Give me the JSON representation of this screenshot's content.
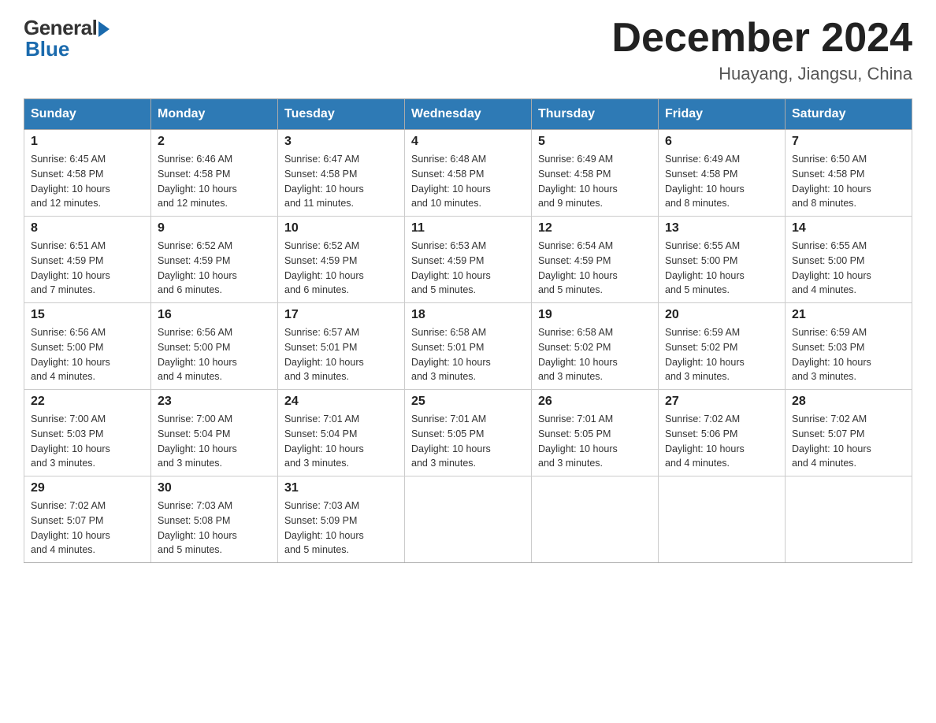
{
  "header": {
    "logo_general": "General",
    "logo_blue": "Blue",
    "month_title": "December 2024",
    "subtitle": "Huayang, Jiangsu, China"
  },
  "days_of_week": [
    "Sunday",
    "Monday",
    "Tuesday",
    "Wednesday",
    "Thursday",
    "Friday",
    "Saturday"
  ],
  "weeks": [
    [
      {
        "day": "1",
        "sunrise": "6:45 AM",
        "sunset": "4:58 PM",
        "daylight": "10 hours and 12 minutes."
      },
      {
        "day": "2",
        "sunrise": "6:46 AM",
        "sunset": "4:58 PM",
        "daylight": "10 hours and 12 minutes."
      },
      {
        "day": "3",
        "sunrise": "6:47 AM",
        "sunset": "4:58 PM",
        "daylight": "10 hours and 11 minutes."
      },
      {
        "day": "4",
        "sunrise": "6:48 AM",
        "sunset": "4:58 PM",
        "daylight": "10 hours and 10 minutes."
      },
      {
        "day": "5",
        "sunrise": "6:49 AM",
        "sunset": "4:58 PM",
        "daylight": "10 hours and 9 minutes."
      },
      {
        "day": "6",
        "sunrise": "6:49 AM",
        "sunset": "4:58 PM",
        "daylight": "10 hours and 8 minutes."
      },
      {
        "day": "7",
        "sunrise": "6:50 AM",
        "sunset": "4:58 PM",
        "daylight": "10 hours and 8 minutes."
      }
    ],
    [
      {
        "day": "8",
        "sunrise": "6:51 AM",
        "sunset": "4:59 PM",
        "daylight": "10 hours and 7 minutes."
      },
      {
        "day": "9",
        "sunrise": "6:52 AM",
        "sunset": "4:59 PM",
        "daylight": "10 hours and 6 minutes."
      },
      {
        "day": "10",
        "sunrise": "6:52 AM",
        "sunset": "4:59 PM",
        "daylight": "10 hours and 6 minutes."
      },
      {
        "day": "11",
        "sunrise": "6:53 AM",
        "sunset": "4:59 PM",
        "daylight": "10 hours and 5 minutes."
      },
      {
        "day": "12",
        "sunrise": "6:54 AM",
        "sunset": "4:59 PM",
        "daylight": "10 hours and 5 minutes."
      },
      {
        "day": "13",
        "sunrise": "6:55 AM",
        "sunset": "5:00 PM",
        "daylight": "10 hours and 5 minutes."
      },
      {
        "day": "14",
        "sunrise": "6:55 AM",
        "sunset": "5:00 PM",
        "daylight": "10 hours and 4 minutes."
      }
    ],
    [
      {
        "day": "15",
        "sunrise": "6:56 AM",
        "sunset": "5:00 PM",
        "daylight": "10 hours and 4 minutes."
      },
      {
        "day": "16",
        "sunrise": "6:56 AM",
        "sunset": "5:00 PM",
        "daylight": "10 hours and 4 minutes."
      },
      {
        "day": "17",
        "sunrise": "6:57 AM",
        "sunset": "5:01 PM",
        "daylight": "10 hours and 3 minutes."
      },
      {
        "day": "18",
        "sunrise": "6:58 AM",
        "sunset": "5:01 PM",
        "daylight": "10 hours and 3 minutes."
      },
      {
        "day": "19",
        "sunrise": "6:58 AM",
        "sunset": "5:02 PM",
        "daylight": "10 hours and 3 minutes."
      },
      {
        "day": "20",
        "sunrise": "6:59 AM",
        "sunset": "5:02 PM",
        "daylight": "10 hours and 3 minutes."
      },
      {
        "day": "21",
        "sunrise": "6:59 AM",
        "sunset": "5:03 PM",
        "daylight": "10 hours and 3 minutes."
      }
    ],
    [
      {
        "day": "22",
        "sunrise": "7:00 AM",
        "sunset": "5:03 PM",
        "daylight": "10 hours and 3 minutes."
      },
      {
        "day": "23",
        "sunrise": "7:00 AM",
        "sunset": "5:04 PM",
        "daylight": "10 hours and 3 minutes."
      },
      {
        "day": "24",
        "sunrise": "7:01 AM",
        "sunset": "5:04 PM",
        "daylight": "10 hours and 3 minutes."
      },
      {
        "day": "25",
        "sunrise": "7:01 AM",
        "sunset": "5:05 PM",
        "daylight": "10 hours and 3 minutes."
      },
      {
        "day": "26",
        "sunrise": "7:01 AM",
        "sunset": "5:05 PM",
        "daylight": "10 hours and 3 minutes."
      },
      {
        "day": "27",
        "sunrise": "7:02 AM",
        "sunset": "5:06 PM",
        "daylight": "10 hours and 4 minutes."
      },
      {
        "day": "28",
        "sunrise": "7:02 AM",
        "sunset": "5:07 PM",
        "daylight": "10 hours and 4 minutes."
      }
    ],
    [
      {
        "day": "29",
        "sunrise": "7:02 AM",
        "sunset": "5:07 PM",
        "daylight": "10 hours and 4 minutes."
      },
      {
        "day": "30",
        "sunrise": "7:03 AM",
        "sunset": "5:08 PM",
        "daylight": "10 hours and 5 minutes."
      },
      {
        "day": "31",
        "sunrise": "7:03 AM",
        "sunset": "5:09 PM",
        "daylight": "10 hours and 5 minutes."
      },
      null,
      null,
      null,
      null
    ]
  ],
  "labels": {
    "sunrise": "Sunrise:",
    "sunset": "Sunset:",
    "daylight": "Daylight:"
  }
}
